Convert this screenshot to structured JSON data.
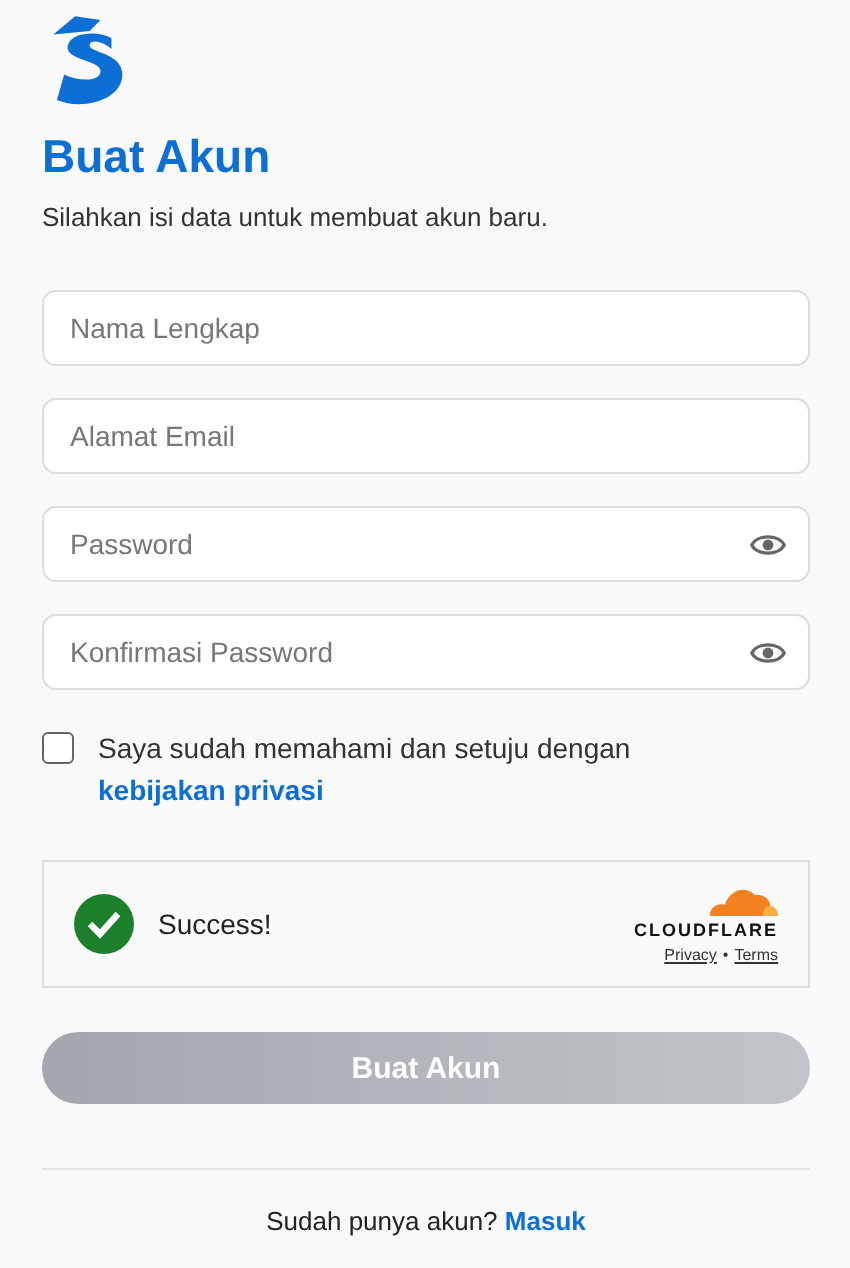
{
  "title": "Buat Akun",
  "subtitle": "Silahkan isi data untuk membuat akun baru.",
  "fields": [
    {
      "placeholder": "Nama Lengkap",
      "kind": "text"
    },
    {
      "placeholder": "Alamat Email",
      "kind": "email"
    },
    {
      "placeholder": "Password",
      "kind": "password"
    },
    {
      "placeholder": "Konfirmasi Password",
      "kind": "password"
    }
  ],
  "agreement": {
    "text": "Saya sudah memahami dan setuju dengan",
    "link": "kebijakan privasi",
    "checked": false
  },
  "captcha": {
    "status": "Success!",
    "success": true,
    "brand": "CLOUDFLARE",
    "links": [
      "Privacy",
      "Terms"
    ],
    "separator": "•"
  },
  "submit": {
    "label": "Buat Akun",
    "disabled": true
  },
  "footer": {
    "text": "Sudah punya akun?",
    "link": "Masuk"
  }
}
